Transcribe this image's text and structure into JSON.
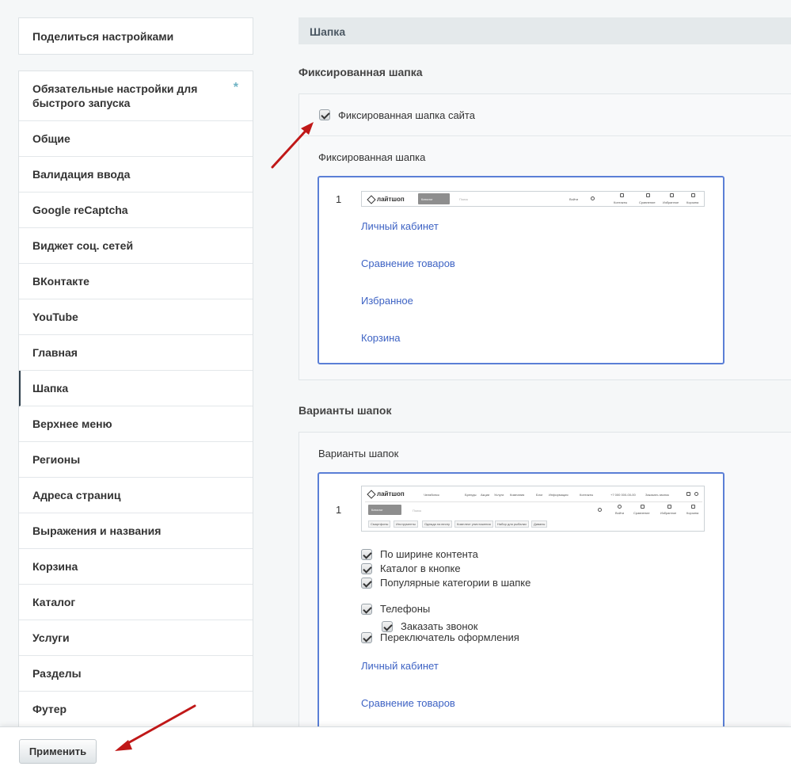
{
  "sidebar": {
    "share": "Поделиться настройками",
    "items": [
      {
        "label": "Обязательные настройки для быстрого запуска",
        "marker": "*"
      },
      {
        "label": "Общие"
      },
      {
        "label": "Валидация ввода"
      },
      {
        "label": "Google reCaptcha"
      },
      {
        "label": "Виджет соц. сетей"
      },
      {
        "label": "ВКонтакте"
      },
      {
        "label": "YouTube"
      },
      {
        "label": "Главная"
      },
      {
        "label": "Шапка"
      },
      {
        "label": "Верхнее меню"
      },
      {
        "label": "Регионы"
      },
      {
        "label": "Адреса страниц"
      },
      {
        "label": "Выражения и названия"
      },
      {
        "label": "Корзина"
      },
      {
        "label": "Каталог"
      },
      {
        "label": "Услуги"
      },
      {
        "label": "Разделы"
      },
      {
        "label": "Футер"
      }
    ],
    "active_index": 8
  },
  "main": {
    "section_title": "Шапка",
    "fixed": {
      "title": "Фиксированная шапка",
      "checkbox_label": "Фиксированная шапка сайта",
      "sub_title": "Фиксированная шапка",
      "variant_number": "1",
      "thumb": {
        "logo": "лайтшоп",
        "catalog": "Каталог",
        "search": "Поиск",
        "login": "Войти",
        "icons": [
          "Контакты",
          "Сравнение",
          "Избранное",
          "Корзина"
        ]
      },
      "links": [
        "Личный кабинет",
        "Сравнение товаров",
        "Избранное",
        "Корзина"
      ]
    },
    "variants": {
      "title": "Варианты шапок",
      "sub_title": "Варианты шапок",
      "variant_number": "1",
      "thumb": {
        "logo": "лайтшоп",
        "city": "Челябинск",
        "menu": [
          "Бренды",
          "Акции",
          "Услуги",
          "Компания",
          "Блог",
          "Информация",
          "Контакты"
        ],
        "phone": "+7 000 000-00-00",
        "callback": "Заказать звонок",
        "catalog": "Каталог",
        "search": "Поиск",
        "icons": [
          "Войти",
          "Сравнение",
          "Избранное",
          "Корзина"
        ],
        "chips": [
          "Смартфоны",
          "Инструменты",
          "Одежда на весну",
          "Комплект уничтожения",
          "Набор для рыбалки",
          "Диваны"
        ]
      },
      "options": [
        "По ширине контента",
        "Каталог в кнопке",
        "Популярные категории в шапке",
        "Телефоны",
        "Заказать звонок",
        "Переключатель оформления"
      ],
      "links": [
        "Личный кабинет",
        "Сравнение товаров"
      ]
    }
  },
  "footer": {
    "apply_label": "Применить"
  },
  "colors": {
    "accent_link": "#3e63c4",
    "frame_border": "#5b7fd6",
    "arrow": "#c01818"
  }
}
